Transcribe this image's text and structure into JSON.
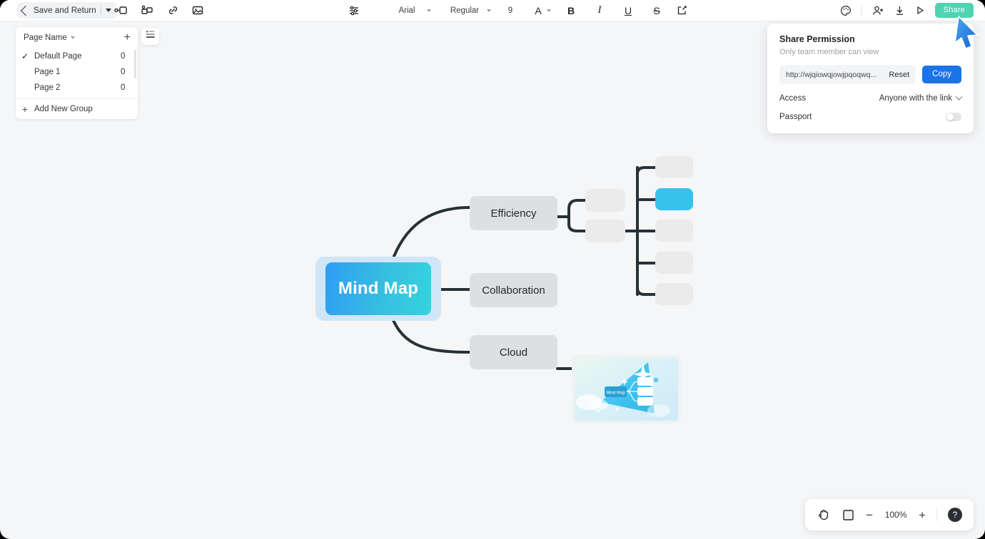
{
  "toolbar": {
    "save_return_label": "Save and Return",
    "icons": {
      "back_chevron": "chevron-left-icon",
      "dropdown": "caret-down-icon",
      "node": "add-node-icon",
      "topic": "add-topic-icon",
      "link": "link-icon",
      "image": "image-icon",
      "settings": "sliders-icon",
      "external": "external-link-icon",
      "palette": "palette-icon",
      "invite": "add-person-icon",
      "download": "download-icon",
      "present": "play-icon"
    },
    "font_family": "Arial",
    "font_weight": "Regular",
    "font_size": "9",
    "text_color_label": "A",
    "bold_label": "B",
    "italic_label": "I",
    "underline_label": "U",
    "strike_label": "S",
    "share_label": "Share"
  },
  "page_panel": {
    "header_label": "Page Name",
    "add_label": "+",
    "rows": [
      {
        "name": "Default Page",
        "count": "0",
        "checked": true
      },
      {
        "name": "Page 1",
        "count": "0",
        "checked": false
      },
      {
        "name": "Page 2",
        "count": "0",
        "checked": false
      }
    ],
    "add_group_label": "Add New Group"
  },
  "share_panel": {
    "title": "Share Permission",
    "subtitle": "Only team member can view",
    "url": "http://wjqiowqjowjpqoqwq...",
    "reset_label": "Reset",
    "copy_label": "Copy",
    "access_label": "Access",
    "access_value": "Anyone with the link",
    "passport_label": "Passport",
    "passport_on": false,
    "copy_color": "#1a73e8"
  },
  "mindmap": {
    "root": "Mind Map",
    "branches": [
      "Efficiency",
      "Collaboration",
      "Cloud"
    ],
    "sub_nodes_efficiency": [
      "",
      ""
    ],
    "sub_nodes_right": [
      "",
      "",
      "",
      "",
      ""
    ],
    "active_sub_index": 1,
    "image_node_label": "Mind Map",
    "colors": {
      "root_gradient_from": "#2f9df4",
      "root_gradient_to": "#35d4de",
      "halo": "#cfe6f8",
      "branch": "#dedfe0",
      "sub": "#ebebeb",
      "sub_active": "#35c3ec",
      "connector": "#263238"
    }
  },
  "bottombar": {
    "pan_icon": "hand-icon",
    "fit_icon": "fit-screen-icon",
    "zoom_out_label": "−",
    "zoom_level": "100%",
    "zoom_in_label": "+",
    "help_label": "?"
  }
}
